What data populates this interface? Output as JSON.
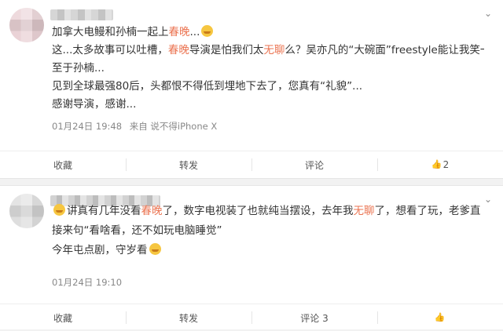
{
  "comments": [
    {
      "lines": [
        [
          {
            "t": "加拿大电鳗和孙楠一起上"
          },
          {
            "t": "春晚",
            "hl": true
          },
          {
            "t": "..."
          },
          {
            "emoji": "grin-emoji"
          }
        ],
        [
          {
            "t": "这...太多故事可以吐槽，"
          },
          {
            "t": "春晚",
            "hl": true
          },
          {
            "t": "导演是怕我们太"
          },
          {
            "t": "无聊",
            "hl": true
          },
          {
            "t": "么？吴亦凡的“大碗面”freestyle能让我笑一晚..."
          }
        ],
        [
          {
            "t": "至于孙楠..."
          }
        ],
        [
          {
            "t": "见到全球最强80后，头都恨不得低到埋地下去了，您真有“礼貌”..."
          }
        ],
        [
          {
            "t": "感谢导演，感谢..."
          }
        ]
      ],
      "meta": {
        "date": "01月24日 19:48",
        "source": "来自 说不得iPhone X"
      },
      "actions": {
        "collect": "收藏",
        "repost": "转发",
        "comment": "评论",
        "like": "2"
      }
    },
    {
      "lines": [
        [
          {
            "emoji": "laugh-emoji"
          },
          {
            "t": "讲真有几年没看"
          },
          {
            "t": "春晚",
            "hl": true
          },
          {
            "t": "了，数字电视装了也就纯当摆设，去年我"
          },
          {
            "t": "无聊",
            "hl": true
          },
          {
            "t": "了，想看了玩，老爹直"
          }
        ],
        [
          {
            "t": "接来句“看啥看，还不如玩电脑睡觉”"
          }
        ],
        [
          {
            "t": "今年屯点剧，守岁看"
          },
          {
            "emoji": "yum-emoji"
          }
        ]
      ],
      "meta": {
        "date": "01月24日 19:10",
        "source": ""
      },
      "actions": {
        "collect": "收藏",
        "repost": "转发",
        "comment": "评论 3",
        "like": ""
      }
    }
  ]
}
